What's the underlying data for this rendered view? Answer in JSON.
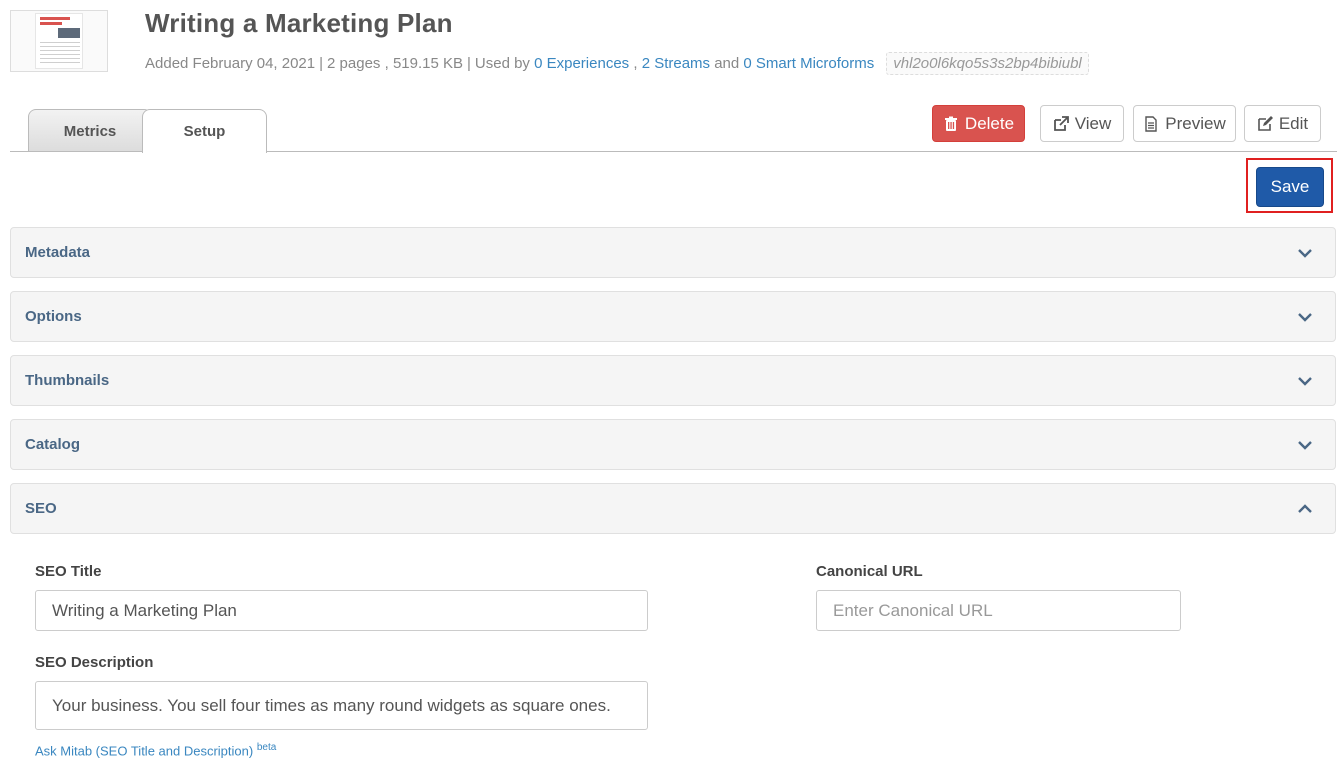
{
  "header": {
    "title": "Writing a Marketing Plan",
    "added": "Added February 04, 2021",
    "pages": "2 pages",
    "size": "519.15 KB",
    "used_by": "Used by",
    "experiences_link": "0 Experiences",
    "streams_link": "2 Streams",
    "and": "and",
    "microforms_link": "0 Smart Microforms",
    "id": "vhl2o0l6kqo5s3s2bp4bibiubl"
  },
  "tabs": [
    {
      "label": "Metrics",
      "active": false
    },
    {
      "label": "Setup",
      "active": true
    }
  ],
  "actions": {
    "delete": "Delete",
    "view": "View",
    "preview": "Preview",
    "edit": "Edit",
    "save": "Save"
  },
  "panels": [
    {
      "label": "Metadata",
      "expanded": false
    },
    {
      "label": "Options",
      "expanded": false
    },
    {
      "label": "Thumbnails",
      "expanded": false
    },
    {
      "label": "Catalog",
      "expanded": false
    },
    {
      "label": "SEO",
      "expanded": true
    }
  ],
  "seo": {
    "title_label": "SEO Title",
    "title_value": "Writing a Marketing Plan",
    "canonical_label": "Canonical URL",
    "canonical_placeholder": "Enter Canonical URL",
    "description_label": "SEO Description",
    "description_value": "Your business. You sell four times as many round widgets as square ones.",
    "ask_link": "Ask Mitab (SEO Title and Description)",
    "ask_badge": "beta"
  },
  "colors": {
    "delete": "#d9534f",
    "save": "#1f5aa8",
    "link": "#3a87c0",
    "highlight": "#e02020"
  }
}
